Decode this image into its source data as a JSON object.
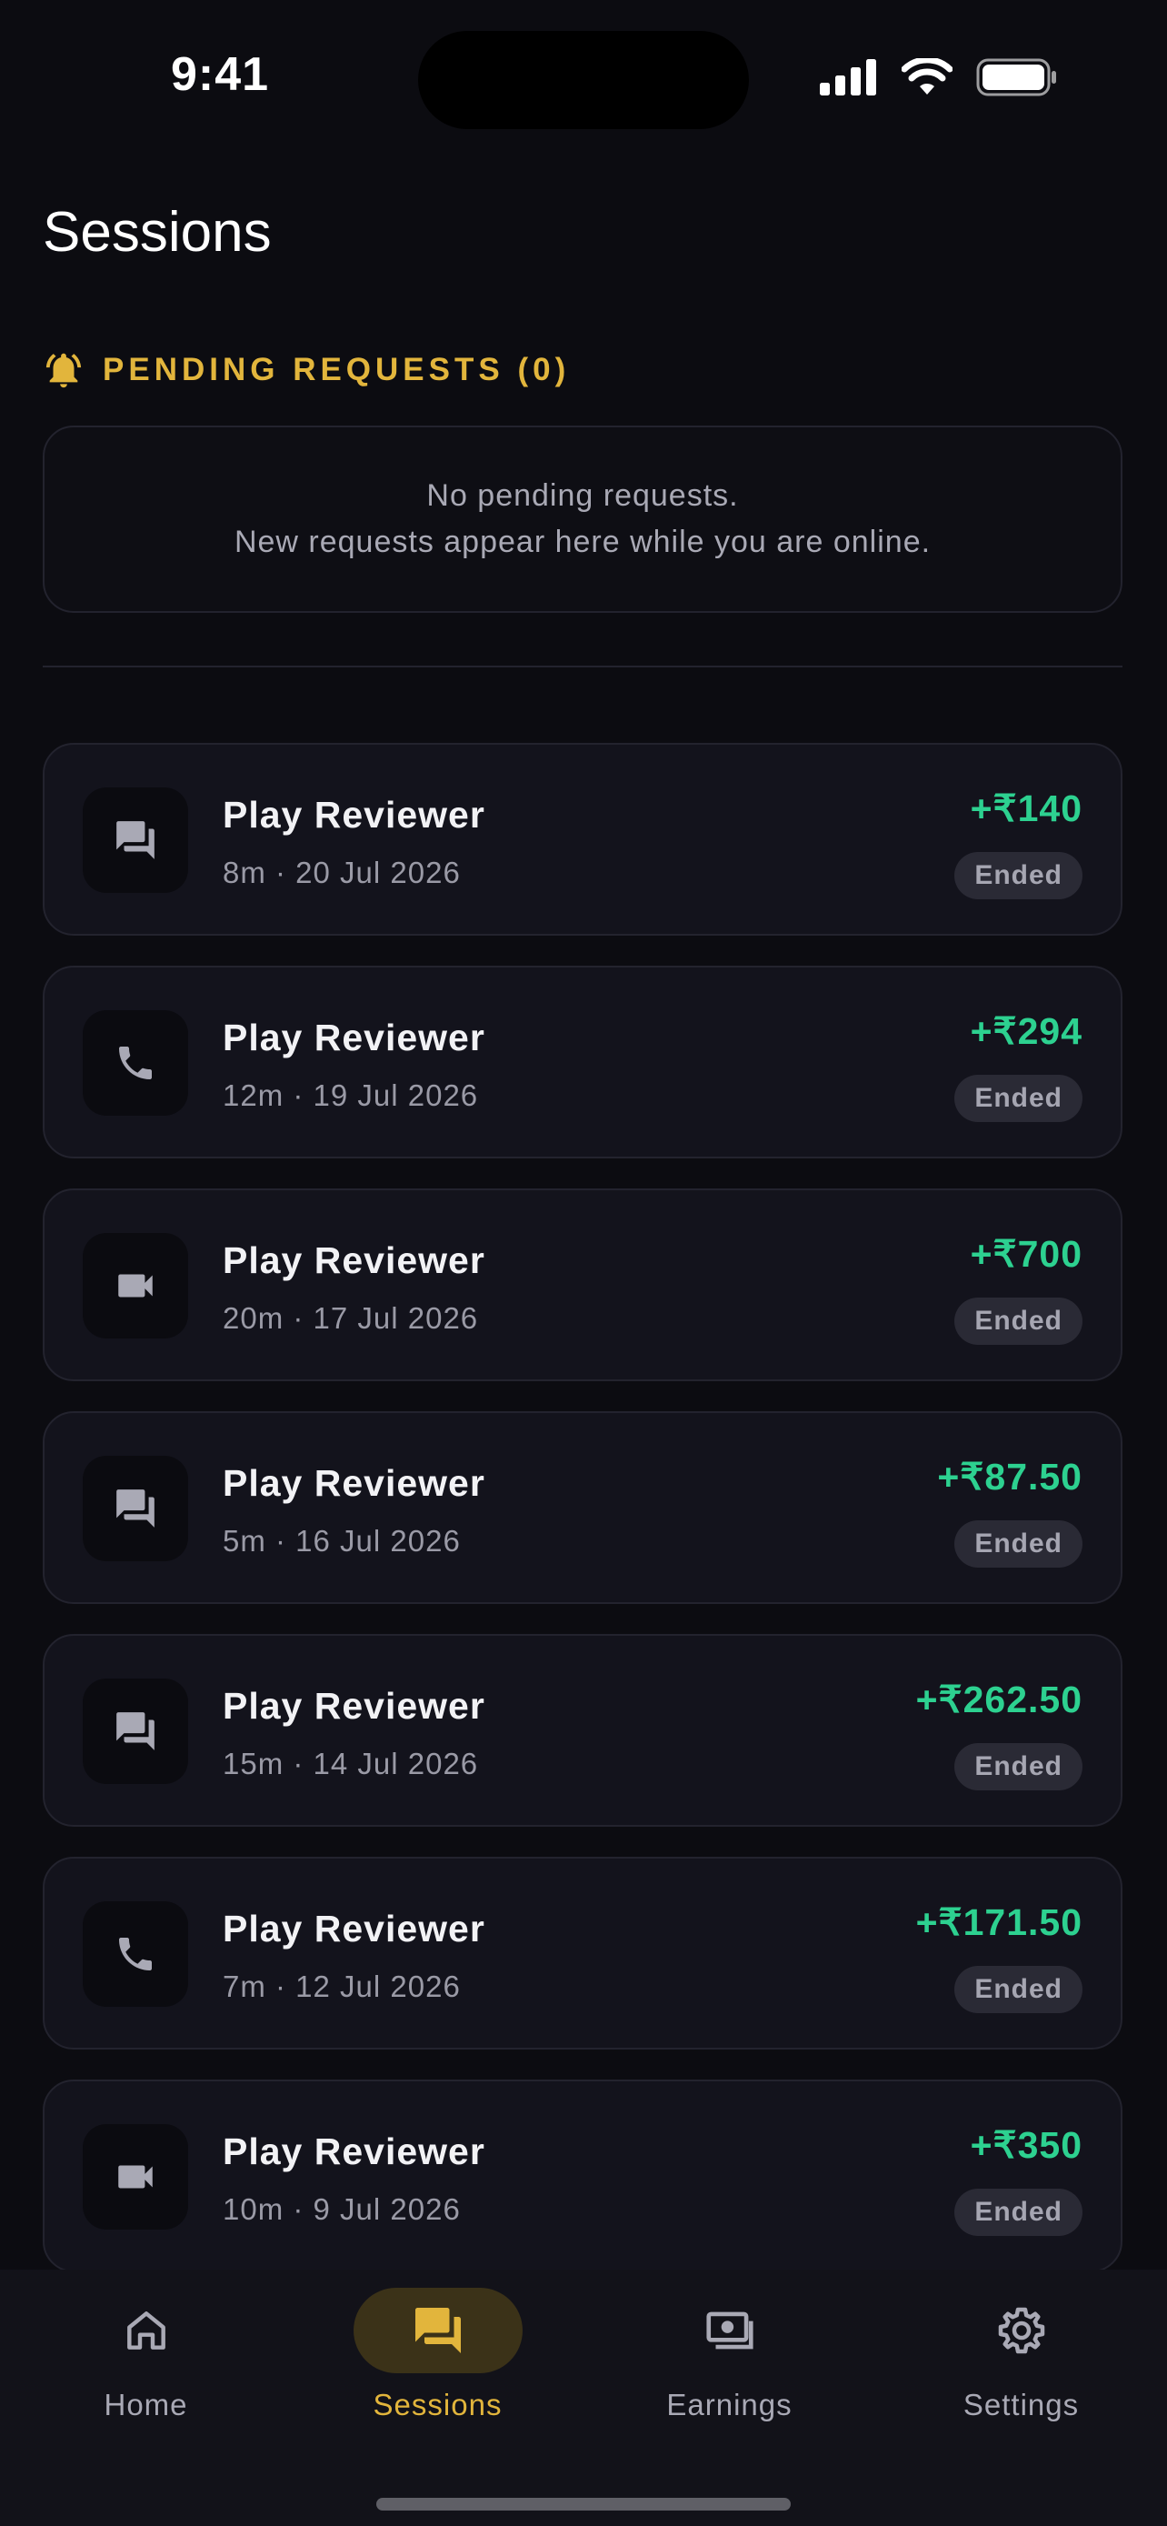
{
  "status_bar": {
    "time": "9:41"
  },
  "page": {
    "title": "Sessions"
  },
  "pending": {
    "header": "PENDING REQUESTS (0)",
    "empty_line1": "No pending requests.",
    "empty_line2": "New requests appear here while you are online."
  },
  "sessions": [
    {
      "type": "chat",
      "icon": "chat-icon",
      "name": "Play Reviewer",
      "meta": "8m · 20 Jul 2026",
      "amount": "+₹140",
      "status": "Ended"
    },
    {
      "type": "call",
      "icon": "phone-icon",
      "name": "Play Reviewer",
      "meta": "12m · 19 Jul 2026",
      "amount": "+₹294",
      "status": "Ended"
    },
    {
      "type": "video",
      "icon": "video-icon",
      "name": "Play Reviewer",
      "meta": "20m · 17 Jul 2026",
      "amount": "+₹700",
      "status": "Ended"
    },
    {
      "type": "chat",
      "icon": "chat-icon",
      "name": "Play Reviewer",
      "meta": "5m · 16 Jul 2026",
      "amount": "+₹87.50",
      "status": "Ended"
    },
    {
      "type": "chat",
      "icon": "chat-icon",
      "name": "Play Reviewer",
      "meta": "15m · 14 Jul 2026",
      "amount": "+₹262.50",
      "status": "Ended"
    },
    {
      "type": "call",
      "icon": "phone-icon",
      "name": "Play Reviewer",
      "meta": "7m · 12 Jul 2026",
      "amount": "+₹171.50",
      "status": "Ended"
    },
    {
      "type": "video",
      "icon": "video-icon",
      "name": "Play Reviewer",
      "meta": "10m · 9 Jul 2026",
      "amount": "+₹350",
      "status": "Ended"
    }
  ],
  "tabs": [
    {
      "label": "Home",
      "icon": "home-icon",
      "active": false
    },
    {
      "label": "Sessions",
      "icon": "chat-icon",
      "active": true
    },
    {
      "label": "Earnings",
      "icon": "cash-icon",
      "active": false
    },
    {
      "label": "Settings",
      "icon": "gear-icon",
      "active": false
    }
  ],
  "colors": {
    "background": "#0c0c11",
    "accent": "#e2b53c",
    "amount": "#2dd190",
    "card": "#13131c",
    "muted": "#9a9aa6"
  }
}
